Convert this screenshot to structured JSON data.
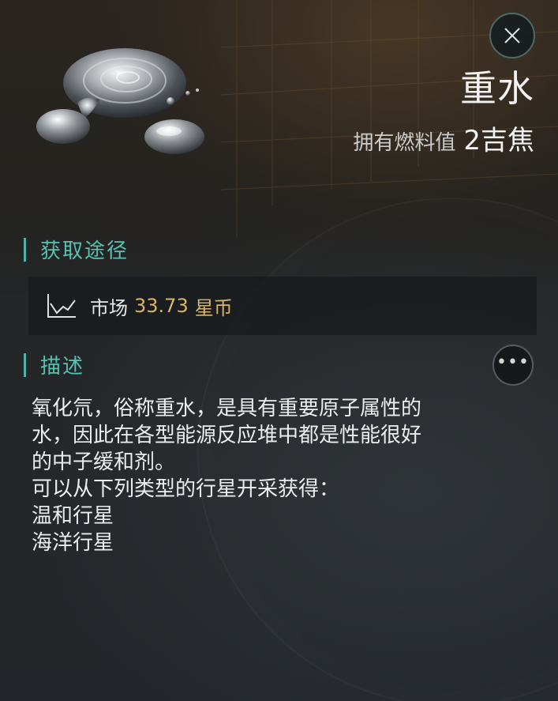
{
  "item": {
    "name": "重水",
    "fuel_label": "拥有燃料值",
    "fuel_value": "2吉焦",
    "icon": "heavy-water-droplets-icon"
  },
  "acquire": {
    "title": "获取途径",
    "market": {
      "icon": "market-chart-icon",
      "label": "市场",
      "price": "33.73",
      "currency": "星币"
    }
  },
  "description": {
    "title": "描述",
    "lines": [
      "氧化氘，俗称重水，是具有重要原子属性的",
      "水，因此在各型能源反应堆中都是性能很好",
      "的中子缓和剂。",
      "可以从下列类型的行星开采获得：",
      "温和行星",
      "海洋行星"
    ]
  },
  "controls": {
    "close_icon": "close-icon",
    "more_icon": "more-icon",
    "more_glyph": "•••"
  },
  "colors": {
    "accent": "#58c2b1",
    "price": "#d7b46a",
    "text": "#ededed"
  }
}
